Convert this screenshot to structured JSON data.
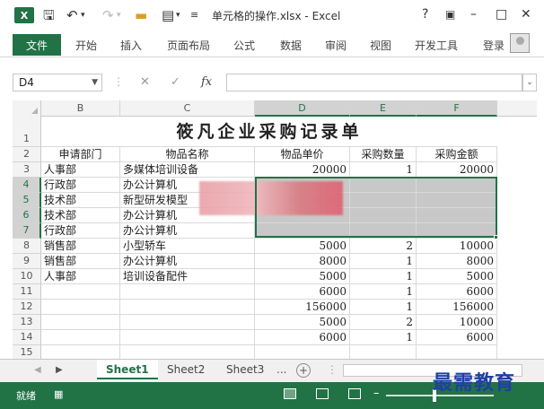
{
  "window": {
    "app_logo": "X",
    "title": "单元格的操作.xlsx - Excel",
    "help": "?",
    "restore": "▣",
    "minimize": "–",
    "maximize": "□",
    "close": "✕"
  },
  "ribbon": {
    "tabs": [
      "文件",
      "开始",
      "插入",
      "页面布局",
      "公式",
      "数据",
      "审阅",
      "视图",
      "开发工具"
    ],
    "login": "登录"
  },
  "formula_bar": {
    "name_box": "D4",
    "cancel": "✕",
    "confirm": "✓",
    "fx": "fx",
    "formula": ""
  },
  "grid": {
    "columns": [
      "B",
      "C",
      "D",
      "E",
      "F"
    ],
    "selected_columns": [
      "D",
      "E",
      "F"
    ],
    "row_numbers": [
      "1",
      "2",
      "3",
      "4",
      "5",
      "6",
      "7",
      "8",
      "9",
      "10",
      "11",
      "12",
      "13",
      "14",
      "15"
    ],
    "selected_rows": [
      "4",
      "5",
      "6",
      "7"
    ],
    "title": "筱凡企业采购记录单",
    "headers": [
      "申请部门",
      "物品名称",
      "物品单价",
      "采购数量",
      "采购金额"
    ],
    "rows": [
      [
        "人事部",
        "多媒体培训设备",
        "20000",
        "1",
        "20000"
      ],
      [
        "行政部",
        "办公计算机",
        "",
        "",
        ""
      ],
      [
        "技术部",
        "新型研发模型",
        "",
        "",
        ""
      ],
      [
        "技术部",
        "办公计算机",
        "",
        "",
        ""
      ],
      [
        "行政部",
        "办公计算机",
        "",
        "",
        ""
      ],
      [
        "销售部",
        "小型轿车",
        "5000",
        "2",
        "10000"
      ],
      [
        "销售部",
        "办公计算机",
        "8000",
        "1",
        "8000"
      ],
      [
        "人事部",
        "培训设备配件",
        "5000",
        "1",
        "5000"
      ],
      [
        "",
        "",
        "6000",
        "1",
        "6000"
      ],
      [
        "",
        "",
        "156000",
        "1",
        "156000"
      ],
      [
        "",
        "",
        "5000",
        "2",
        "10000"
      ],
      [
        "",
        "",
        "6000",
        "1",
        "6000"
      ],
      [
        "",
        "",
        "",
        "",
        ""
      ]
    ]
  },
  "sheets": {
    "tabs": [
      "Sheet1",
      "Sheet2",
      "Sheet3"
    ],
    "active": "Sheet1",
    "more": "...",
    "add": "+"
  },
  "status": {
    "mode": "就绪"
  },
  "watermark": "最需教育",
  "colors": {
    "excel_green": "#217346",
    "selection_shade": "#c8c8c8",
    "watermark_blue": "#1f3fa3"
  }
}
